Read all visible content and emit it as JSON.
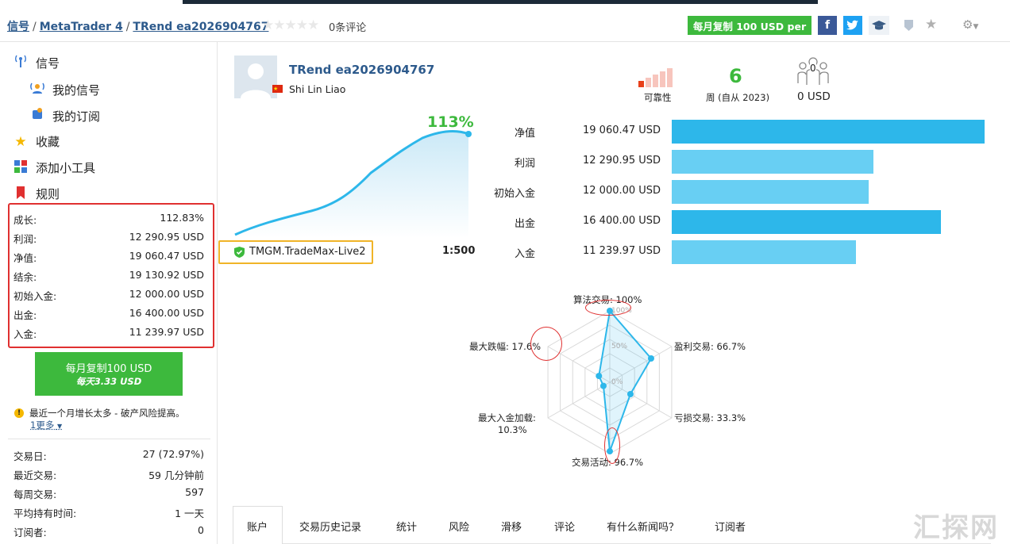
{
  "breadcrumb": {
    "signals": "信号",
    "platform": "MetaTrader 4",
    "name": "TRend ea2026904767"
  },
  "rating": {
    "reviews": "0条评论"
  },
  "header": {
    "copy_button": "每月复制 100 USD per"
  },
  "sidebar": {
    "nav": [
      {
        "label": "信号",
        "icon": "antenna-icon"
      },
      {
        "label": "我的信号",
        "icon": "broadcast-user-icon"
      },
      {
        "label": "我的订阅",
        "icon": "subscription-icon"
      },
      {
        "label": "收藏",
        "icon": "star-icon"
      },
      {
        "label": "添加小工具",
        "icon": "widget-icon"
      },
      {
        "label": "规则",
        "icon": "bookmark-icon"
      }
    ],
    "stats": [
      {
        "label": "成长:",
        "value": "112.83%"
      },
      {
        "label": "利润:",
        "value": "12 290.95 USD"
      },
      {
        "label": "净值:",
        "value": "19 060.47 USD"
      },
      {
        "label": "结余:",
        "value": "19 130.92 USD"
      },
      {
        "label": "初始入金:",
        "value": "12 000.00 USD"
      },
      {
        "label": "出金:",
        "value": "16 400.00 USD"
      },
      {
        "label": "入金:",
        "value": "11 239.97 USD"
      }
    ],
    "copy_button": {
      "line1": "每月复制100 USD",
      "line2": "每天3.33 USD"
    },
    "warning": "最近一个月增长太多 - 破产风险提高。",
    "more": "1更多",
    "stats2": [
      {
        "label": "交易日:",
        "value": "27 (72.97%)"
      },
      {
        "label": "最近交易:",
        "value": "59 几分钟前"
      },
      {
        "label": "每周交易:",
        "value": "597"
      },
      {
        "label": "平均持有时间:",
        "value": "1 一天"
      },
      {
        "label": "订阅者:",
        "value": "0"
      }
    ]
  },
  "profile": {
    "name": "TRend ea2026904767",
    "author": "Shi Lin Liao"
  },
  "summary": {
    "reliability_label": "可靠性",
    "weeks_value": "6",
    "weeks_label": "周 (自从 2023)",
    "subscribers_count": "0",
    "subscribers_value": "0 USD"
  },
  "growth": {
    "percent": "113%",
    "server": "TMGM.TradeMax-Live2",
    "leverage": "1:500"
  },
  "balance_bars": [
    {
      "label": "净值",
      "value": "19 060.47 USD",
      "amount": 19060.47
    },
    {
      "label": "利润",
      "value": "12 290.95 USD",
      "amount": 12290.95
    },
    {
      "label": "初始入金",
      "value": "12 000.00 USD",
      "amount": 12000.0
    },
    {
      "label": "出金",
      "value": "16 400.00 USD",
      "amount": 16400.0
    },
    {
      "label": "入金",
      "value": "11 239.97 USD",
      "amount": 11239.97
    }
  ],
  "radar": {
    "axes": [
      {
        "label": "算法交易: 100%",
        "value": 100
      },
      {
        "label": "盈利交易: 66.7%",
        "value": 66.7
      },
      {
        "label": "亏损交易: 33.3%",
        "value": 33.3
      },
      {
        "label": "交易活动: 96.7%",
        "value": 96.7
      },
      {
        "label": "最大入金加载:",
        "label2": "10.3%",
        "value": 10.3
      },
      {
        "label": "最大跌幅: 17.6%",
        "value": 17.6
      }
    ],
    "ticks": [
      "100%",
      "50%",
      "0%"
    ]
  },
  "tabs": [
    "账户",
    "交易历史记录",
    "统计",
    "风险",
    "滑移",
    "评论",
    "有什么新闻吗？",
    "订阅者"
  ],
  "watermark": "汇探网",
  "colors": {
    "accent": "#2db7ea",
    "bar_light": "#68cff3",
    "green": "#3db93d",
    "red": "#e03030",
    "orange": "#f0b428"
  }
}
